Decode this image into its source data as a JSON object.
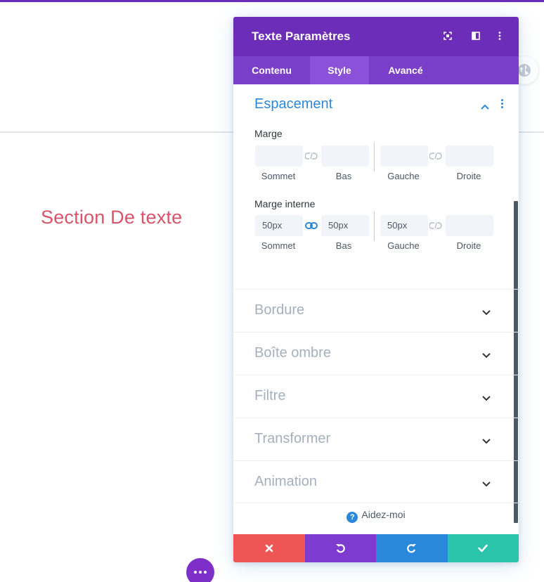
{
  "page": {
    "section_text": "Section De texte"
  },
  "modal": {
    "title": "Texte Paramètres",
    "header_icons": [
      "fullscreen-icon",
      "split-view-icon",
      "more-vertical-icon"
    ],
    "tabs": [
      {
        "label": "Contenu",
        "active": false
      },
      {
        "label": "Style",
        "active": true
      },
      {
        "label": "Avancé",
        "active": false
      }
    ],
    "section": {
      "title": "Espacement",
      "margin": {
        "label": "Marge",
        "fields": [
          {
            "label": "Sommet",
            "value": ""
          },
          {
            "label": "Bas",
            "value": ""
          },
          {
            "label": "Gauche",
            "value": ""
          },
          {
            "label": "Droite",
            "value": ""
          }
        ],
        "linked_top_bottom": false,
        "linked_left_right": false
      },
      "padding": {
        "label": "Marge interne",
        "fields": [
          {
            "label": "Sommet",
            "value": "50px"
          },
          {
            "label": "Bas",
            "value": "50px"
          },
          {
            "label": "Gauche",
            "value": "50px"
          },
          {
            "label": "Droite",
            "value": ""
          }
        ],
        "linked_top_bottom": true,
        "linked_left_right": false
      }
    },
    "accordions": [
      {
        "label": "Bordure"
      },
      {
        "label": "Boîte ombre"
      },
      {
        "label": "Filtre"
      },
      {
        "label": "Transformer"
      },
      {
        "label": "Animation"
      }
    ],
    "help_label": "Aidez-moi",
    "footer_buttons": [
      {
        "name": "discard",
        "icon": "close-icon",
        "color": "#ef5555"
      },
      {
        "name": "undo",
        "icon": "undo-icon",
        "color": "#7e3bd0"
      },
      {
        "name": "redo",
        "icon": "redo-icon",
        "color": "#2b87da"
      },
      {
        "name": "save",
        "icon": "check-icon",
        "color": "#29c4a9"
      }
    ]
  },
  "colors": {
    "header": "#6c2eb9",
    "tabs": "#7a3fc8",
    "active_tab": "#8b51d8",
    "accent_blue": "#2b87da",
    "section_text": "#d9546a"
  }
}
